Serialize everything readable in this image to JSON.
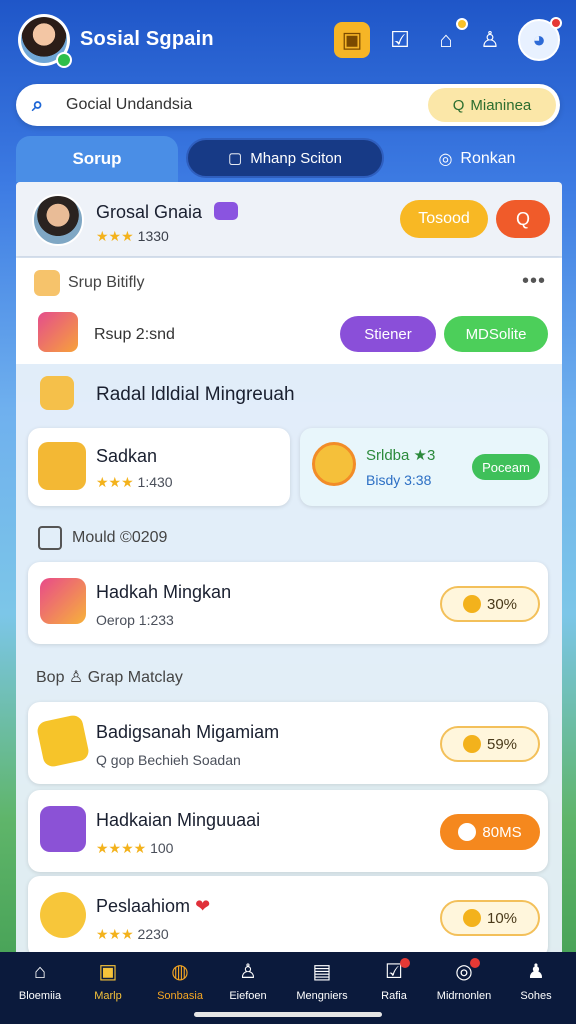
{
  "header": {
    "app_title": "Sosial Sgpain",
    "icons": [
      "treasure-chest-icon",
      "checklist-icon",
      "home-icon",
      "user-add-icon",
      "mascot-icon"
    ]
  },
  "search": {
    "value": "Gocial Undandsia",
    "chip_label": "Mianinea"
  },
  "tabs": [
    {
      "label": "Sorup",
      "active": true
    },
    {
      "label": "Mhanp Sciton",
      "active": false
    },
    {
      "label": "Ronkan",
      "active": false
    }
  ],
  "profile": {
    "name": "Grosal Gnaia",
    "rating_stars": "★★★",
    "rating_value": "1330",
    "btn_primary": "Tosood",
    "btn_secondary": "Q"
  },
  "activity": {
    "title": "Srup Bitifly",
    "subtitle": "Rsup 2:snd",
    "btn_purple": "Stiener",
    "btn_green": "MDSolite",
    "more": "•••"
  },
  "section1": {
    "title": "Radal ldldial Mingreuah"
  },
  "mini_cards": [
    {
      "title": "Sadkan",
      "stars": "★★★",
      "value": "1:430",
      "accent": "#f3b21c"
    },
    {
      "title": "Srldba",
      "suffix": "★3",
      "sub": "Bisdy 3:38",
      "btn": "Poceam"
    }
  ],
  "sub_section1": {
    "title": "Mould ©0209"
  },
  "list1": [
    {
      "title": "Hadkah Mingkan",
      "sub": "Oerop 1:233",
      "pill": "30%",
      "pill_style": "light"
    }
  ],
  "sub_section2": {
    "title": "Grap Matclay",
    "prefix": "Bop"
  },
  "list2": [
    {
      "title": "Badigsanah Migamiam",
      "sub": "Q gop  Bechieh   Soadan",
      "pill": "59%",
      "pill_style": "light"
    },
    {
      "title": "Hadkaian Minguuaai",
      "sub_stars": "★★★★",
      "sub": "100",
      "pill": "80MS",
      "pill_style": "orange"
    },
    {
      "title": "Peslaahiom",
      "title_suffix": "❤",
      "sub_stars": "★★★",
      "sub": "2230",
      "pill": "10%",
      "pill_style": "light"
    }
  ],
  "bottom_nav": [
    {
      "label": "Bloemiia",
      "icon": "home-icon"
    },
    {
      "label": "Marlp",
      "icon": "frame-icon",
      "active": "yellow"
    },
    {
      "label": "Sonbasia",
      "icon": "chat-icon",
      "active": "orange"
    },
    {
      "label": "Eiefoen",
      "icon": "person-icon"
    },
    {
      "label": "Mengniers",
      "icon": "card-icon"
    },
    {
      "label": "Rafia",
      "icon": "checklist-icon",
      "badge": true
    },
    {
      "label": "Midrnonlen",
      "icon": "target-icon",
      "badge": true
    },
    {
      "label": "Sohes",
      "icon": "profile-icon"
    }
  ],
  "colors": {
    "brand_blue": "#1f56c8",
    "accent_yellow": "#f8b824",
    "accent_red": "#f05b2a",
    "accent_purple": "#8a4fd9",
    "accent_green": "#4ccf5a",
    "accent_orange": "#f5881e",
    "nav_bg": "#0b1a3c"
  }
}
